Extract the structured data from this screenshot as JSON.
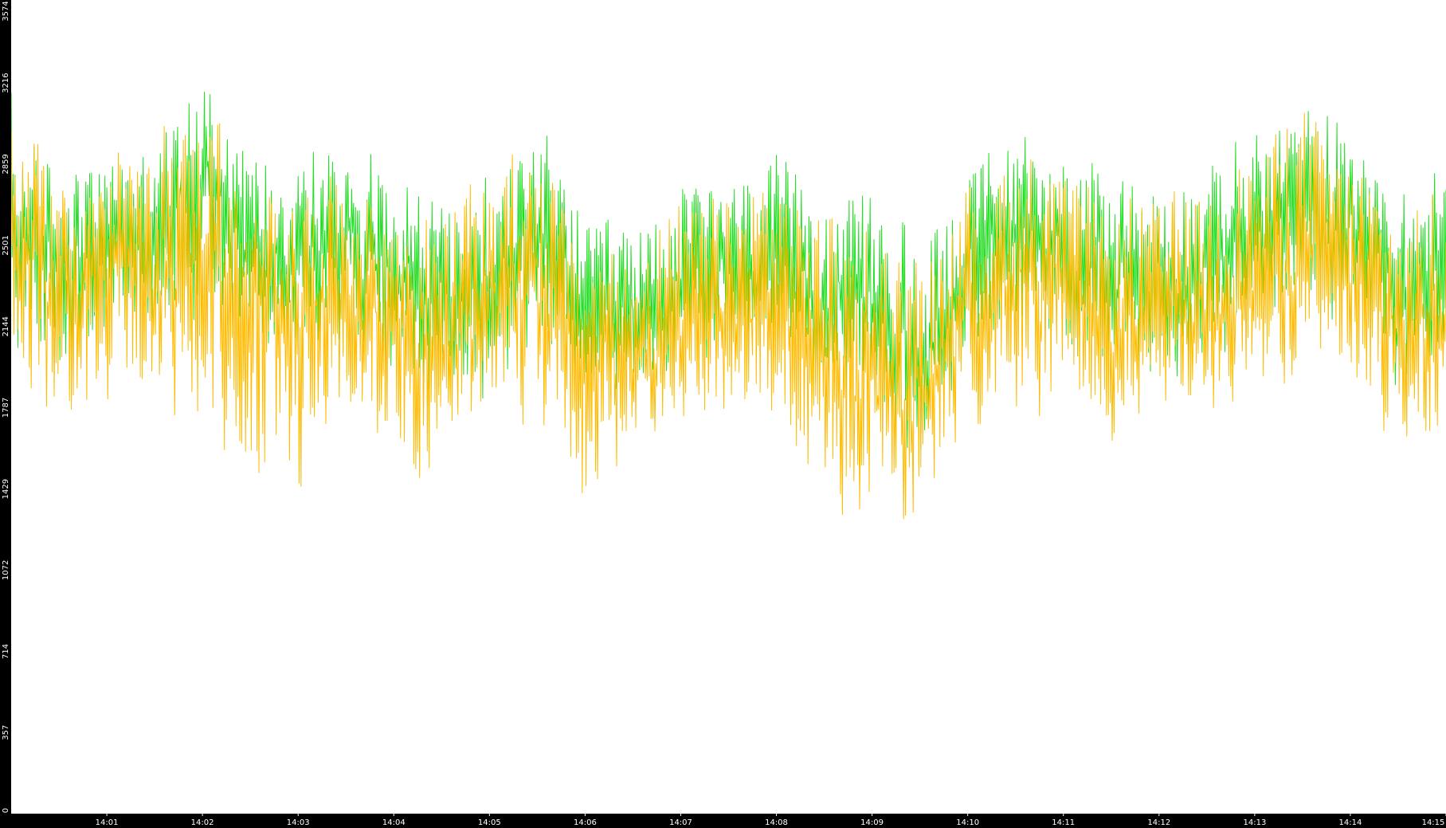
{
  "chart_data": {
    "type": "line",
    "title": "",
    "xlabel": "",
    "ylabel": "",
    "ylim": [
      0,
      3574
    ],
    "y_ticks": [
      0,
      357,
      714,
      1072,
      1429,
      1787,
      2144,
      2501,
      2859,
      3216,
      3574
    ],
    "x_ticks": [
      "14:01",
      "14:02",
      "14:03",
      "14:04",
      "14:05",
      "14:06",
      "14:07",
      "14:08",
      "14:09",
      "14:10",
      "14:11",
      "14:12",
      "14:13",
      "14:14",
      "14:15"
    ],
    "x_range_minutes": [
      0,
      15
    ],
    "floor_value": 1000,
    "grid": false,
    "legend": "none",
    "colors": {
      "background": "#ffffff",
      "axis": "#000000",
      "tick_text": "#ffffff",
      "series_a": "#22dd22",
      "series_b": "#ffbb00"
    },
    "series": [
      {
        "color": "#22dd22",
        "x": [
          0,
          0.5,
          1,
          1.5,
          2,
          2.5,
          3,
          3.5,
          4,
          4.5,
          5,
          5.5,
          6,
          6.5,
          7,
          7.5,
          8,
          8.5,
          9,
          9.5,
          10,
          10.5,
          11,
          11.5,
          12,
          12.5,
          13,
          13.5,
          14,
          14.5,
          15
        ],
        "mean": [
          2600,
          2450,
          2550,
          2650,
          2900,
          2450,
          2450,
          2500,
          2350,
          2250,
          2350,
          2600,
          2200,
          2150,
          2300,
          2350,
          2400,
          2300,
          2200,
          1950,
          2400,
          2600,
          2500,
          2350,
          2350,
          2400,
          2500,
          2700,
          2600,
          2200,
          2350
        ],
        "low": [
          1800,
          1700,
          1850,
          1900,
          1750,
          1900,
          1850,
          1800,
          1700,
          1500,
          1600,
          1800,
          1600,
          1700,
          1800,
          1750,
          1800,
          1700,
          1600,
          1300,
          1800,
          1900,
          1800,
          1700,
          1700,
          1800,
          1900,
          2100,
          1950,
          1600,
          1700
        ],
        "high": [
          3200,
          3100,
          3150,
          3150,
          3550,
          3150,
          3150,
          3150,
          3050,
          2950,
          3000,
          3300,
          2850,
          2800,
          3000,
          3000,
          3100,
          3000,
          2950,
          2750,
          3150,
          3200,
          3150,
          3050,
          3050,
          3100,
          3200,
          3350,
          3250,
          2950,
          3100
        ]
      },
      {
        "color": "#ffbb00",
        "x": [
          0,
          0.5,
          1,
          1.5,
          2,
          2.5,
          3,
          3.5,
          4,
          4.5,
          5,
          5.5,
          6,
          6.5,
          7,
          7.5,
          8,
          8.5,
          9,
          9.5,
          10,
          10.5,
          11,
          11.5,
          12,
          12.5,
          13,
          13.5,
          14,
          14.5,
          15
        ],
        "mean": [
          2500,
          2300,
          2400,
          2400,
          2550,
          2200,
          2300,
          2300,
          2150,
          2050,
          2200,
          2300,
          2000,
          1950,
          2100,
          2150,
          2200,
          2000,
          1850,
          1750,
          2200,
          2400,
          2250,
          2150,
          2150,
          2200,
          2300,
          2450,
          2350,
          2000,
          2200
        ],
        "low": [
          1600,
          1400,
          1500,
          1500,
          1300,
          1050,
          1050,
          1600,
          1300,
          1050,
          1500,
          1450,
          1050,
          1400,
          1500,
          1500,
          1500,
          1050,
          1050,
          1050,
          1500,
          1500,
          1400,
          1400,
          1500,
          1500,
          1600,
          1700,
          1600,
          1400,
          1350
        ],
        "high": [
          3250,
          3100,
          3150,
          3200,
          3574,
          3000,
          3050,
          3100,
          2950,
          2900,
          3100,
          3250,
          2800,
          2750,
          2950,
          3000,
          3200,
          3000,
          2900,
          2700,
          3000,
          3150,
          3100,
          2950,
          2950,
          3000,
          3200,
          3450,
          3200,
          2950,
          3000
        ]
      }
    ]
  }
}
